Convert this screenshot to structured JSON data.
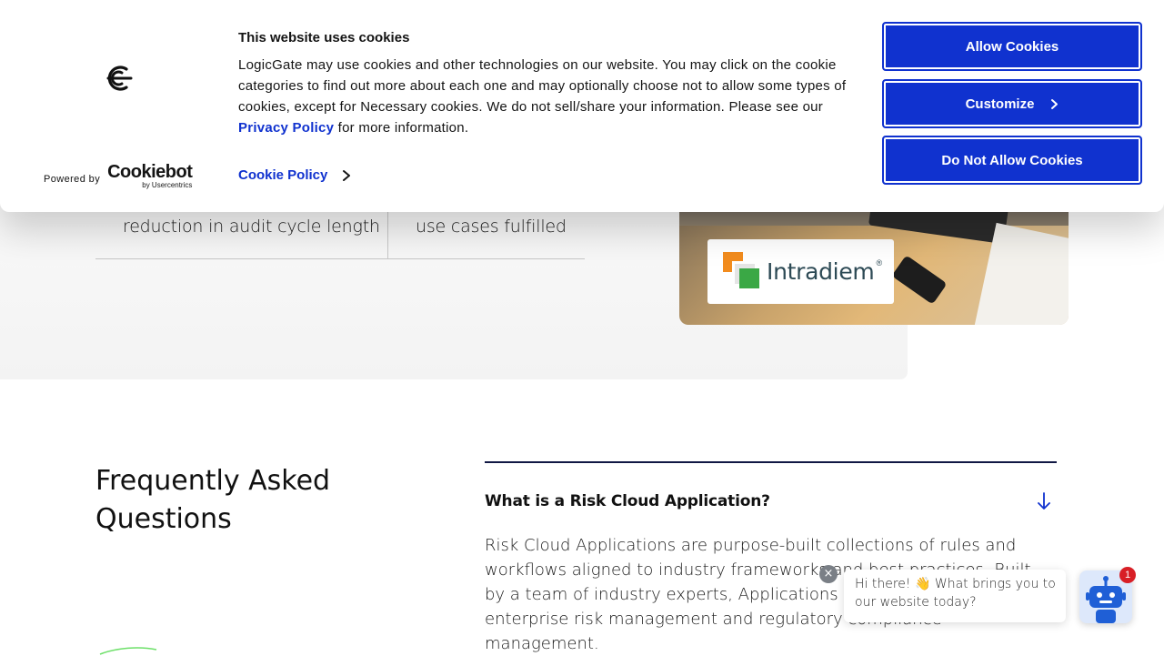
{
  "stats": {
    "stat_a": "reduction in audit cycle length",
    "stat_b": "use cases fulfilled"
  },
  "case_study": {
    "logo_text": "Intradiem",
    "logo_reg": "®"
  },
  "faq": {
    "title": "Frequently Asked Questions",
    "question": "What is a Risk Cloud Application?",
    "answer": "Risk Cloud Applications are purpose-built collections of rules and workflows aligned to industry frameworks and best practices. Built by a team of industry experts, Applications support use cases in enterprise risk management and regulatory compliance management."
  },
  "cookie_banner": {
    "title": "This website uses cookies",
    "body_before_link": "LogicGate may use cookies and other technologies on our website. You may click on the cookie categories to find out more about each one and may optionally choose not to allow some types of cookies, except for Necessary cookies.  We do not sell/share your information. Please see our ",
    "privacy_link": "Privacy Policy",
    "body_after_link": " for more information.",
    "cookie_policy_link": "Cookie Policy",
    "powered_by": "Powered by",
    "cookiebot": "Cookiebot",
    "by_usercentrics": "by Usercentrics",
    "buttons": {
      "allow": "Allow Cookies",
      "customize": "Customize",
      "deny": "Do Not Allow Cookies"
    }
  },
  "chat": {
    "message": "Hi there! 👋 What brings you to our website today?",
    "close": "×",
    "badge_count": "1"
  },
  "colors": {
    "brand_blue": "#1032cf",
    "faq_rule": "#111844",
    "badge_red": "#d81f26"
  },
  "icons": {
    "brand": "logicgate-logo-icon",
    "chevron": "chevron-right-icon",
    "faq_toggle": "arrow-down-icon",
    "chat": "robot-icon"
  }
}
